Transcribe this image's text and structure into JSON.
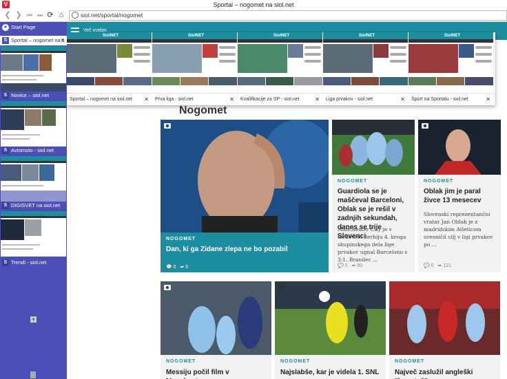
{
  "window": {
    "title": "Sportal – nogomet na siol.net"
  },
  "address": {
    "url": "siol.net/sportal/nogomet"
  },
  "panel": {
    "start_label": "Start Page",
    "tabs": [
      {
        "label": "Sportal – nogomet na s",
        "active": true
      },
      {
        "label": "Novice – siol.net",
        "active": false
      },
      {
        "label": "Avtomoto - siol.net",
        "active": false
      },
      {
        "label": "DIGISVET na siol.net",
        "active": false
      },
      {
        "label": "Trendi - siol.net",
        "active": false
      }
    ],
    "thumb_logo": "SiolNET"
  },
  "site": {
    "menu_label": "Več vsebin",
    "logo": "SiolNET"
  },
  "tabstrip": [
    {
      "caption": "Sportal – nogomet na siol.net"
    },
    {
      "caption": "Prva liga - siol.net"
    },
    {
      "caption": "Kvalifikacije za SP - siol.net"
    },
    {
      "caption": "Liga prvakov - siol.net"
    },
    {
      "caption": "Šport na Sportalu - siol.net"
    }
  ],
  "section": {
    "title": "Nogomet"
  },
  "articles": [
    {
      "category": "NOGOMET",
      "title": "Dan, ki ga Zidane zlepa ne bo pozabil",
      "comments": "0",
      "shares": "0"
    },
    {
      "category": "NOGOMET",
      "title": "Guardiola se je maščeval Barceloni, Oblak se je rešil v zadnjih sekundah, danes se trije Slovenci",
      "lead": "Manchester City je v torkovem derbiju 4. kroga skupinskega dela lige prvakov ugnal Barcelono s 3:1. Branilec ...",
      "comments": "0",
      "shares": "80"
    },
    {
      "category": "NOGOMET",
      "title": "Oblak jim je paral živce 13 mesecev",
      "lead": "Slovenski reprezentančni vratar Jan Oblak je z madridskim Atleticom uresničil cilj v ligi prvakov po ...",
      "comments": "0",
      "shares": "121"
    },
    {
      "category": "NOGOMET",
      "title": "Messiju počil film v Manchestru"
    },
    {
      "category": "NOGOMET",
      "title": "Najslabše, kar je videla 1. SNL"
    },
    {
      "category": "NOGOMET",
      "title": "Največ zaslužil angleški \"bogataš\","
    }
  ]
}
